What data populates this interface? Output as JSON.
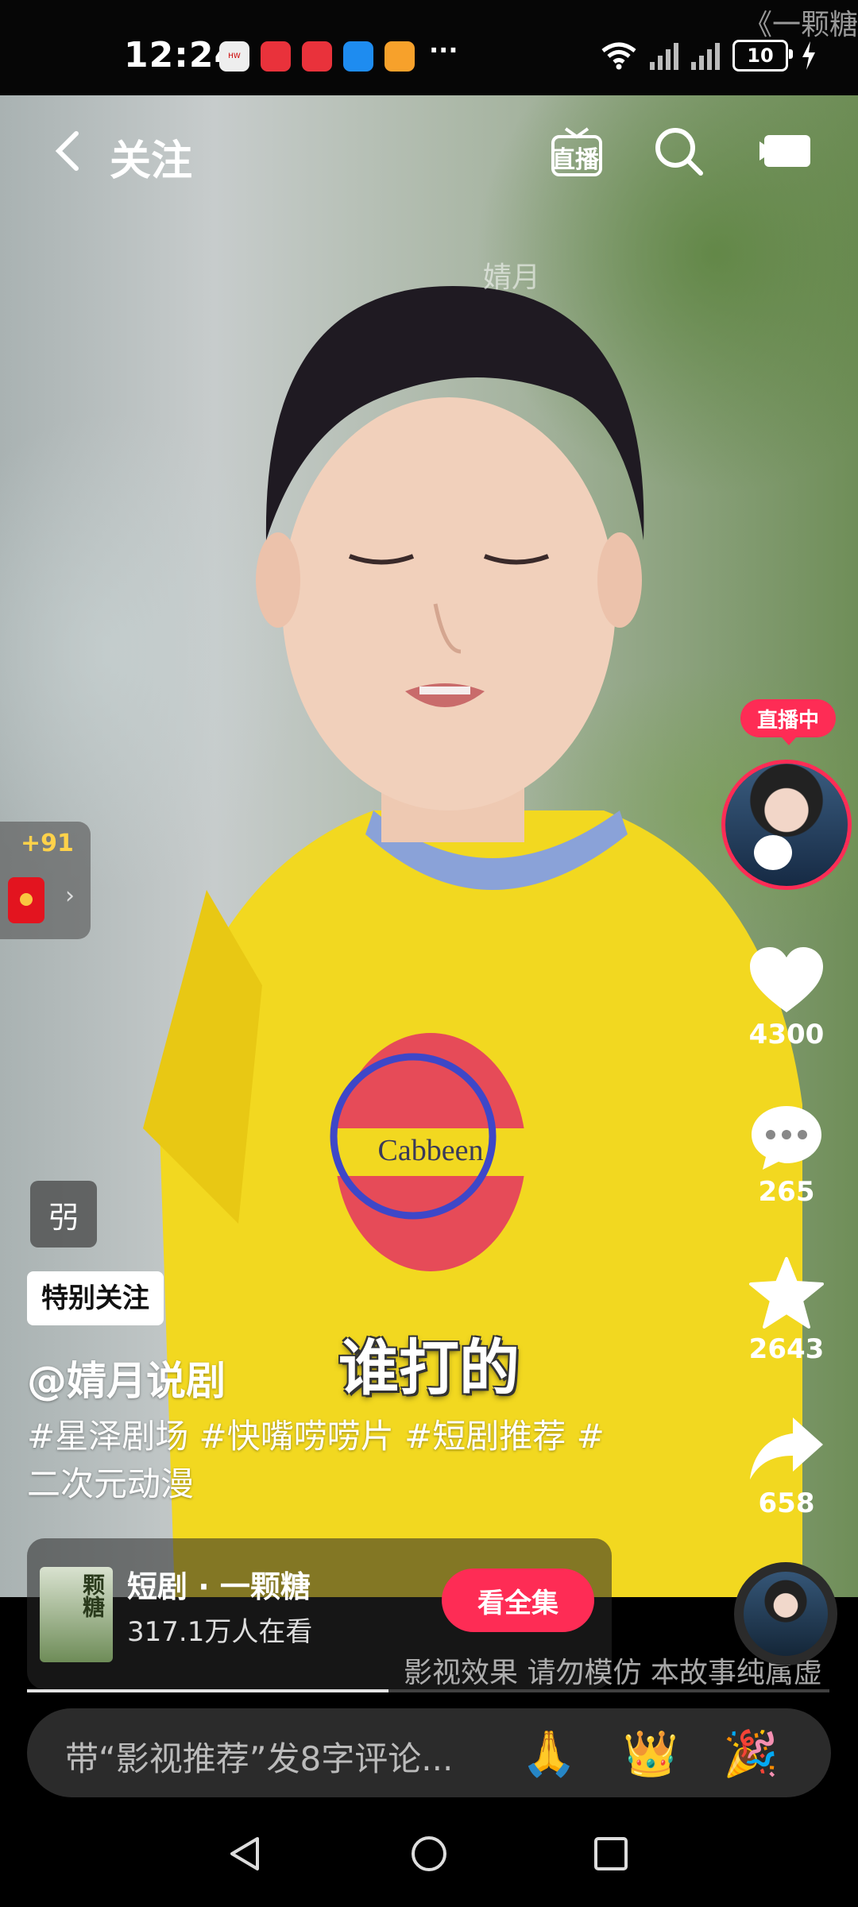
{
  "status_bar": {
    "time": "12:24",
    "app_icons": [
      "huawei-app-icon",
      "red-book-icon",
      "red-app-icon",
      "blue-search-app-icon",
      "orange-video-app-icon"
    ],
    "more": "···",
    "battery": "10",
    "corner_text": "《一颗糖"
  },
  "top_bar": {
    "title": "关注",
    "live_label": "直播",
    "watermark": "婧月"
  },
  "reward": {
    "plus": "+91"
  },
  "right_rail": {
    "live_badge": "直播中",
    "like_count": "4300",
    "comment_count": "265",
    "favorite_count": "2643",
    "share_count": "658"
  },
  "video": {
    "tag_chip": "弜",
    "special_follow": "特别关注",
    "username": "@婧月说剧",
    "hashtags": "#星泽剧场 #快嘴唠唠片 #短剧推荐 #二次元动漫",
    "subtitle": "谁打的",
    "disclaimer": "影视效果 请勿模仿 本故事纯属虚",
    "progress": 0.45
  },
  "drama_card": {
    "thumb_text": "颗糖",
    "title": "短剧 · 一颗糖",
    "viewers": "317.1万人在看",
    "button": "看全集"
  },
  "comment_bar": {
    "placeholder": "带“影视推荐”发8字评论...",
    "emojis": [
      "🙏",
      "👑",
      "🎉"
    ]
  }
}
